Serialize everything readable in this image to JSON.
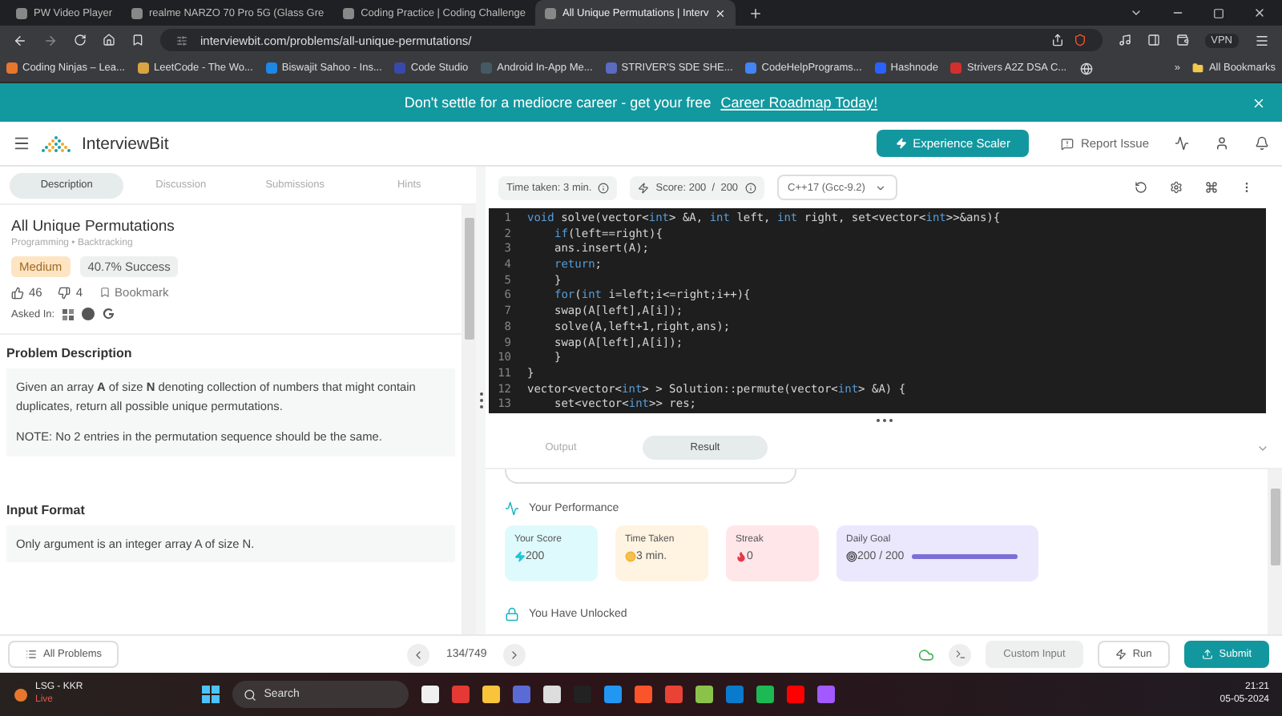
{
  "browser": {
    "tabs": [
      {
        "label": "PW Video Player",
        "selected": false
      },
      {
        "label": "realme NARZO 70 Pro 5G (Glass Gre",
        "selected": false
      },
      {
        "label": "Coding Practice | Coding Challenge",
        "selected": false
      },
      {
        "label": "All Unique Permutations | Interv",
        "selected": true
      }
    ],
    "address": "interviewbit.com/problems/all-unique-permutations/",
    "vpn": "VPN",
    "bookmarks": [
      {
        "label": "Coding Ninjas – Lea...",
        "color": "#e8772e"
      },
      {
        "label": "LeetCode - The Wo...",
        "color": "#d9a441"
      },
      {
        "label": "Biswajit Sahoo - Ins...",
        "color": "#1e88e5"
      },
      {
        "label": "Code Studio",
        "color": "#3949ab"
      },
      {
        "label": "Android In-App Me...",
        "color": "#455a64"
      },
      {
        "label": "STRIVER'S SDE SHE...",
        "color": "#5c6bc0"
      },
      {
        "label": "CodeHelpPrograms...",
        "color": "#4285f4"
      },
      {
        "label": "Hashnode",
        "color": "#2962ff"
      },
      {
        "label": "Strivers A2Z DSA C...",
        "color": "#d32f2f"
      }
    ],
    "more_bookmarks": "»",
    "all_bookmarks": "All Bookmarks"
  },
  "banner": {
    "text": "Don't settle for a mediocre career - get your free",
    "link": "Career Roadmap Today!"
  },
  "header": {
    "logo": "InterviewBit",
    "cta": "Experience Scaler",
    "report": "Report Issue"
  },
  "problem": {
    "tabs": [
      {
        "label": "Description",
        "selected": true
      },
      {
        "label": "Discussion",
        "selected": false
      },
      {
        "label": "Submissions",
        "selected": false
      },
      {
        "label": "Hints",
        "selected": false
      }
    ],
    "title": "All Unique Permutations",
    "tags": "Programming • Backtracking",
    "difficulty": "Medium",
    "success": "40.7% Success",
    "likes": "46",
    "dislikes": "4",
    "bookmark": "Bookmark",
    "asked_in": "Asked In:",
    "sections": [
      {
        "heading": "Problem Description",
        "paragraphs": [
          "Given an array **A** of size **N** denoting collection of numbers that might contain duplicates, return all possible unique permutations.",
          "NOTE: No 2 entries in the permutation sequence should be the same."
        ]
      },
      {
        "heading": "Input Format",
        "paragraphs": [
          "Only argument is an integer array A of size N."
        ]
      }
    ]
  },
  "editor": {
    "time_taken": "Time taken: 3 min.",
    "score": "Score: 200  /  200",
    "language": "C++17 (Gcc-9.2)",
    "lines": [
      {
        "n": "1",
        "indent": false,
        "code": [
          {
            "kw": true,
            "t": "void"
          },
          {
            "kw": false,
            "t": " solve(vector<"
          },
          {
            "kw": true,
            "t": "int"
          },
          {
            "kw": false,
            "t": "> &A, "
          },
          {
            "kw": true,
            "t": "int"
          },
          {
            "kw": false,
            "t": " left, "
          },
          {
            "kw": true,
            "t": "int"
          },
          {
            "kw": false,
            "t": " right, set<vector<"
          },
          {
            "kw": true,
            "t": "int"
          },
          {
            "kw": false,
            "t": ">>&ans){"
          }
        ]
      },
      {
        "n": "2",
        "indent": true,
        "code": [
          {
            "kw": true,
            "t": "if"
          },
          {
            "kw": false,
            "t": "(left==right){"
          }
        ]
      },
      {
        "n": "3",
        "indent": true,
        "code": [
          {
            "kw": false,
            "t": "ans.insert(A);"
          }
        ]
      },
      {
        "n": "4",
        "indent": true,
        "code": [
          {
            "kw": true,
            "t": "return"
          },
          {
            "kw": false,
            "t": ";"
          }
        ]
      },
      {
        "n": "5",
        "indent": true,
        "code": [
          {
            "kw": false,
            "t": "}"
          }
        ]
      },
      {
        "n": "6",
        "indent": true,
        "code": [
          {
            "kw": true,
            "t": "for"
          },
          {
            "kw": false,
            "t": "("
          },
          {
            "kw": true,
            "t": "int"
          },
          {
            "kw": false,
            "t": " i=left;i<=right;i++){"
          }
        ]
      },
      {
        "n": "7",
        "indent": true,
        "code": [
          {
            "kw": false,
            "t": "swap(A[left],A[i]);"
          }
        ]
      },
      {
        "n": "8",
        "indent": true,
        "code": [
          {
            "kw": false,
            "t": "solve(A,left+1,right,ans);"
          }
        ]
      },
      {
        "n": "9",
        "indent": true,
        "code": [
          {
            "kw": false,
            "t": "swap(A[left],A[i]);"
          }
        ]
      },
      {
        "n": "10",
        "indent": true,
        "code": [
          {
            "kw": false,
            "t": "}"
          }
        ]
      },
      {
        "n": "11",
        "indent": false,
        "code": [
          {
            "kw": false,
            "t": "}"
          }
        ]
      },
      {
        "n": "12",
        "indent": false,
        "code": [
          {
            "kw": false,
            "t": "vector<vector<"
          },
          {
            "kw": true,
            "t": "int"
          },
          {
            "kw": false,
            "t": "> > Solution::permute(vector<"
          },
          {
            "kw": true,
            "t": "int"
          },
          {
            "kw": false,
            "t": "> &A) {"
          }
        ]
      },
      {
        "n": "13",
        "indent": true,
        "code": [
          {
            "kw": false,
            "t": "set<vector<"
          },
          {
            "kw": true,
            "t": "int"
          },
          {
            "kw": false,
            "t": ">> res;"
          }
        ]
      }
    ]
  },
  "results": {
    "tabs": [
      {
        "label": "Output",
        "selected": false
      },
      {
        "label": "Result",
        "selected": true
      }
    ],
    "performance_title": "Your Performance",
    "stats": [
      {
        "kind": "score",
        "label": "Your Score",
        "value": "200"
      },
      {
        "kind": "time",
        "label": "Time Taken",
        "value": "3 min."
      },
      {
        "kind": "streak",
        "label": "Streak",
        "value": "0"
      },
      {
        "kind": "goal",
        "label": "Daily Goal",
        "value": "200 / 200",
        "level": 1
      }
    ],
    "unlocked": "You Have Unlocked"
  },
  "footer": {
    "all_problems": "All Problems",
    "pager": "134/749",
    "custom_input": "Custom Input",
    "run": "Run",
    "submit": "Submit"
  },
  "taskbar": {
    "weather_title": "LSG - KKR",
    "weather_sub": "Live",
    "search": "Search",
    "time": "21:21",
    "date": "05-05-2024"
  }
}
